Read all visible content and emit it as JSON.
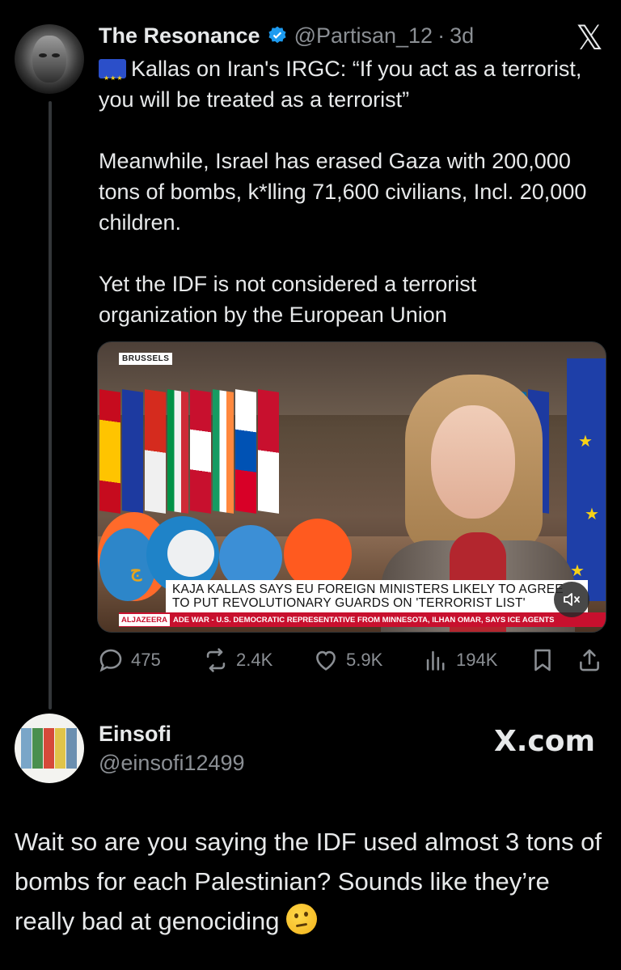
{
  "tweet": {
    "author_name": "The Resonance",
    "handle": "@Partisan_12",
    "separator": "·",
    "time": "3d",
    "flag_icon": "eu-flag-icon",
    "paragraphs": [
      "Kallas on Iran's IRGC: “If you act as a terrorist, you will be treated as a terrorist”",
      "Meanwhile, Israel has erased Gaza with 200,000 tons of bombs, k*lling 71,600 civilians, Incl. 20,000 children.",
      "Yet the IDF is not considered a terrorist organization by the European Union"
    ],
    "media": {
      "location_tag": "BRUSSELS",
      "headline_line1": "KAJA KALLAS SAYS EU FOREIGN MINISTERS LIKELY TO AGREE",
      "headline_line2": "TO PUT REVOLUTIONARY GUARDS ON 'TERRORIST LIST'",
      "channel_tag": "ALJAZEERA",
      "ticker": "ADE WAR  -  U.S. DEMOCRATIC REPRESENTATIVE FROM MINNESOTA, ILHAN OMAR, SAYS ICE AGENTS"
    },
    "stats": {
      "replies": "475",
      "reposts": "2.4K",
      "likes": "5.9K",
      "views": "194K"
    }
  },
  "reply": {
    "author_name": "Einsofi",
    "handle": "@einsofi12499",
    "watermark": "X.com",
    "text": "Wait so are you saying the IDF used almost 3 tons of bombs for each Palestinian? Sounds like they’re really bad at genociding",
    "emoji": "thinking-face-emoji"
  },
  "colors": {
    "background": "#000000",
    "text": "#e7e9ea",
    "secondary": "#8b8f94",
    "verified": "#1d9bf0",
    "ticker_red": "#c8102e"
  }
}
